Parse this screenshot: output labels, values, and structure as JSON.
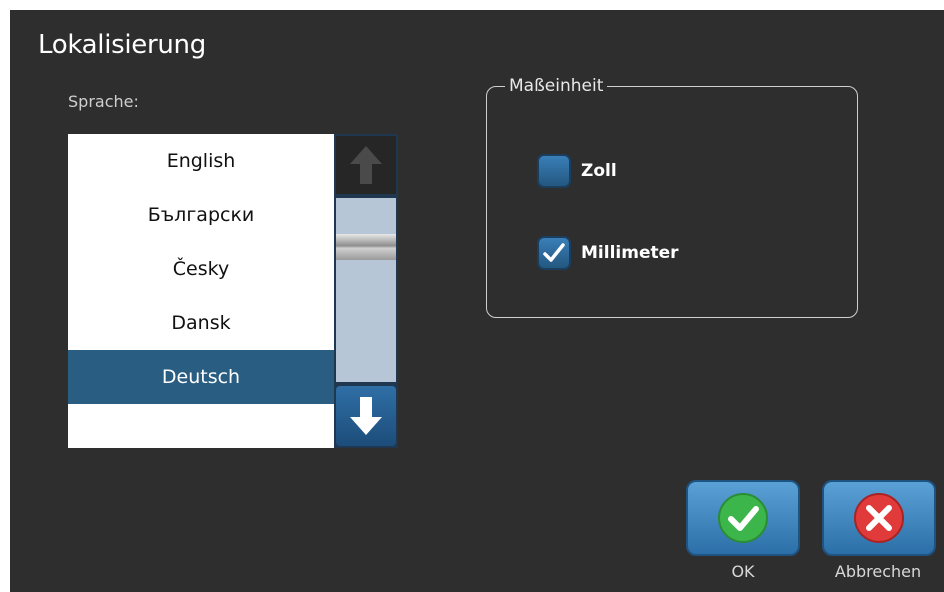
{
  "dialog": {
    "title": "Lokalisierung"
  },
  "language": {
    "label": "Sprache:",
    "items": [
      {
        "label": "English"
      },
      {
        "label": "Български"
      },
      {
        "label": "Česky"
      },
      {
        "label": "Dansk"
      },
      {
        "label": "Deutsch",
        "selected": true
      }
    ]
  },
  "units": {
    "legend": "Maßeinheit",
    "options": [
      {
        "label": "Zoll",
        "checked": false
      },
      {
        "label": "Millimeter",
        "checked": true
      }
    ]
  },
  "buttons": {
    "ok_label": "OK",
    "cancel_label": "Abbrechen"
  },
  "icons": {
    "scroll_up": "arrow-up-icon",
    "scroll_down": "arrow-down-icon",
    "ok": "check-icon",
    "cancel": "x-icon",
    "checkmark": "checkmark-icon"
  },
  "colors": {
    "background": "#2e2e2e",
    "selection": "#2a5d82",
    "ok_green": "#3cb54a",
    "cancel_red": "#e03a3a"
  }
}
